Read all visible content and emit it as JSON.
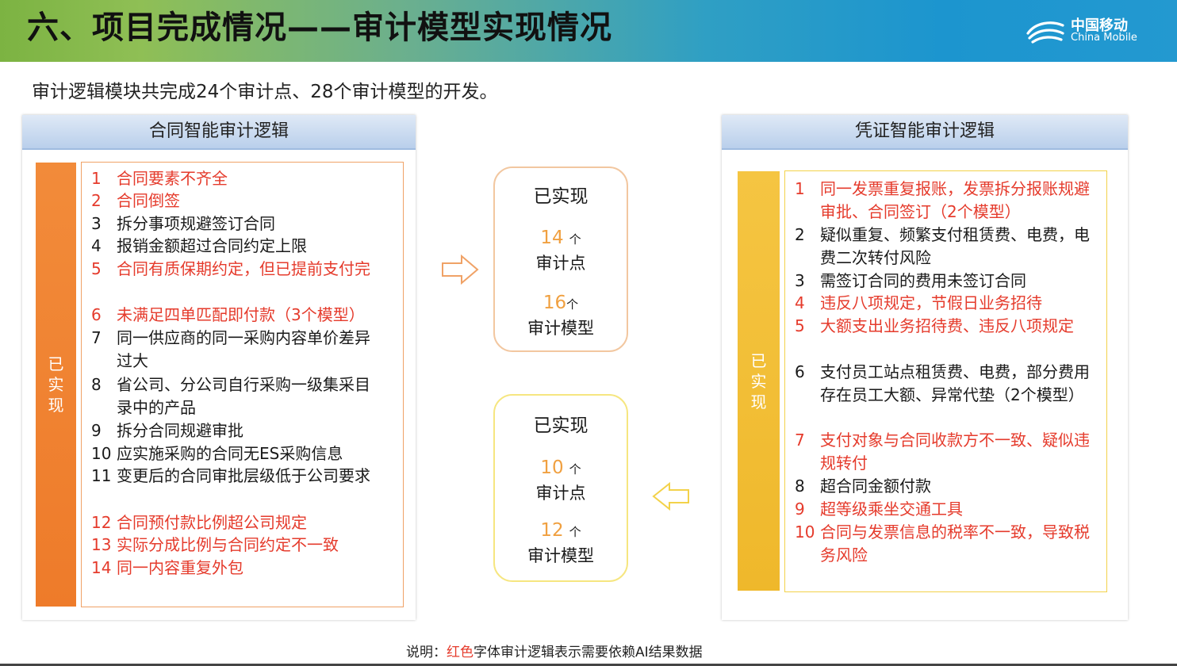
{
  "title": "六、项目完成情况——审计模型实现情况",
  "logo": {
    "cn": "中国移动",
    "en": "China Mobile"
  },
  "intro": "审计逻辑模块共完成24个审计点、28个审计模型的开发。",
  "left_panel": {
    "header": "合同智能审计逻辑",
    "side_label": "已实现",
    "items": [
      {
        "num": "1",
        "text": "合同要素不齐全",
        "color": "red"
      },
      {
        "num": "2",
        "text": "合同倒签",
        "color": "red"
      },
      {
        "num": "3",
        "text": "拆分事项规避签订合同",
        "color": "black"
      },
      {
        "num": "4",
        "text": "报销金额超过合同约定上限",
        "color": "black"
      },
      {
        "num": "5",
        "text": "合同有质保期约定，但已提前支付完",
        "color": "red"
      },
      {
        "num": "6",
        "text": "未满足四单匹配即付款（3个模型）",
        "color": "red"
      },
      {
        "num": "7",
        "text": "同一供应商的同一采购内容单价差异过大",
        "color": "black"
      },
      {
        "num": "8",
        "text": "省公司、分公司自行采购一级集采目录中的产品",
        "color": "black"
      },
      {
        "num": "9",
        "text": "拆分合同规避审批",
        "color": "black"
      },
      {
        "num": "10",
        "text": "应实施采购的合同无ES采购信息",
        "color": "black"
      },
      {
        "num": "11",
        "text": "变更后的合同审批层级低于公司要求",
        "color": "black"
      },
      {
        "num": "12",
        "text": "合同预付款比例超公司规定",
        "color": "red"
      },
      {
        "num": "13",
        "text": "实际分成比例与合同约定不一致",
        "color": "red"
      },
      {
        "num": "14",
        "text": "同一内容重复外包",
        "color": "red"
      }
    ]
  },
  "right_panel": {
    "header": "凭证智能审计逻辑",
    "side_label": "已实现",
    "items": [
      {
        "num": "1",
        "text": "同一发票重复报账，发票拆分报账规避审批、合同签订（2个模型）",
        "color": "red"
      },
      {
        "num": "2",
        "text": "疑似重复、频繁支付租赁费、电费，电费二次转付风险",
        "color": "black"
      },
      {
        "num": "3",
        "text": "需签订合同的费用未签订合同",
        "color": "black"
      },
      {
        "num": "4",
        "text": "违反八项规定，节假日业务招待",
        "color": "red"
      },
      {
        "num": "5",
        "text": "大额支出业务招待费、违反八项规定",
        "color": "red"
      },
      {
        "num": "6",
        "text": "支付员工站点租赁费、电费，部分费用存在员工大额、异常代垫（2个模型）",
        "color": "black"
      },
      {
        "num": "7",
        "text": "支付对象与合同收款方不一致、疑似违规转付",
        "color": "red"
      },
      {
        "num": "8",
        "text": "超合同金额付款",
        "color": "black"
      },
      {
        "num": "9",
        "text": "超等级乘坐交通工具",
        "color": "red"
      },
      {
        "num": "10",
        "text": "合同与发票信息的税率不一致，导致税务风险",
        "color": "red"
      }
    ]
  },
  "center_top": {
    "heading": "已实现",
    "points_num": "14",
    "unit": "个",
    "points_label": "审计点",
    "models_num": "16",
    "models_label": "审计模型"
  },
  "center_bottom": {
    "heading": "已实现",
    "points_num": "10",
    "unit": "个",
    "points_label": "审计点",
    "models_num": "12",
    "models_label": "审计模型"
  },
  "note": {
    "prefix": "说明：",
    "red": "红色",
    "suffix": "字体审计逻辑表示需要依赖AI结果数据"
  },
  "colors": {
    "red": "#e53b2c",
    "orange": "#ee7b2a",
    "yellow": "#f5c542",
    "number": "#f0a040"
  }
}
